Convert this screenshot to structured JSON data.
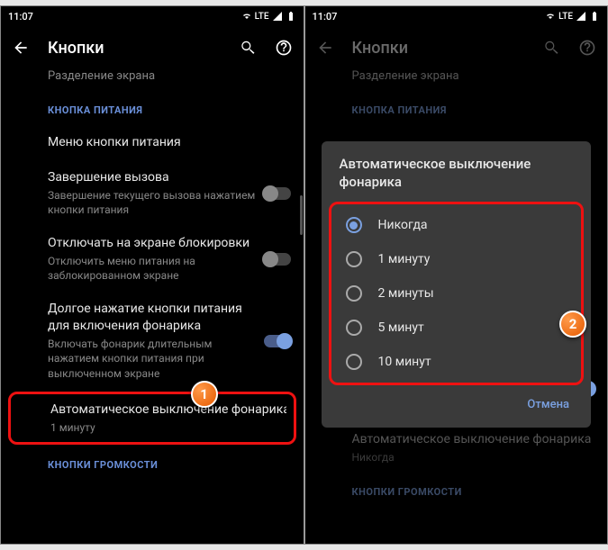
{
  "status": {
    "time": "11:07",
    "network": "LTE",
    "signal": "B"
  },
  "appbar": {
    "title": "Кнопки",
    "subtitle": "Разделение экрана"
  },
  "section_power": "КНОПКА ПИТАНИЯ",
  "section_volume": "КНОПКИ ГРОМКОСТИ",
  "rows": {
    "power_menu": "Меню кнопки питания",
    "end_call": {
      "t": "Завершение вызова",
      "s": "Завершение текущего вызова нажатием кнопки питания"
    },
    "lock_screen": {
      "t": "Отключать на экране блокировки",
      "s": "Отключить меню питания на заблокированном экране"
    },
    "long_press": {
      "t": "Долгое нажатие кнопки питания для включения фонарика",
      "s": "Включать фонарик длительным нажатием кнопки питания при выключенном экране"
    },
    "auto_off_left": {
      "t": "Автоматическое выключение фонарика",
      "s": "1 минуту"
    },
    "auto_off_right": {
      "t": "Автоматическое выключение фонарика",
      "s": "Никогда"
    }
  },
  "dialog": {
    "title": "Автоматическое выключение фонарика",
    "options": [
      "Никогда",
      "1 минуту",
      "2 минуты",
      "5 минут",
      "10 минут"
    ],
    "cancel": "Отмена"
  },
  "badges": {
    "one": "1",
    "two": "2"
  }
}
